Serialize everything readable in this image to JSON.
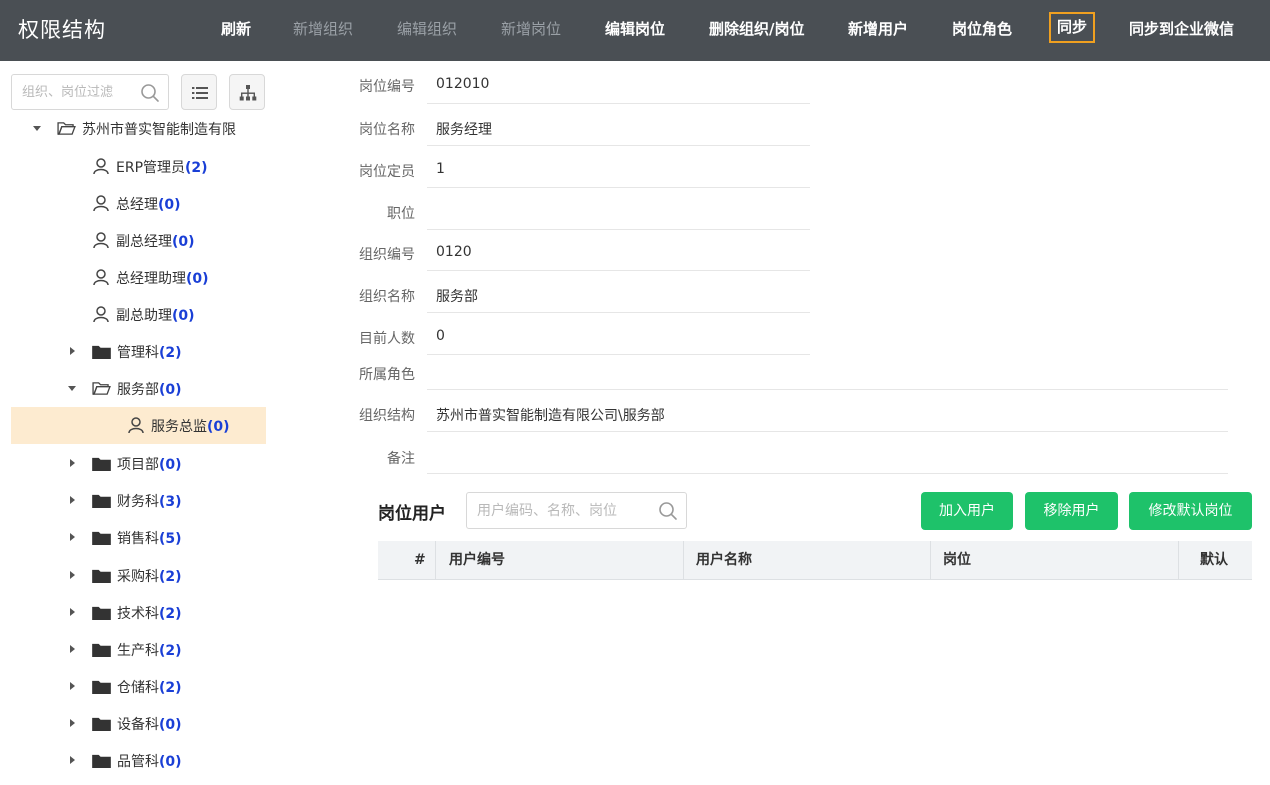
{
  "header": {
    "title": "权限结构",
    "toolbar": [
      {
        "label": "刷新",
        "enabled": true
      },
      {
        "label": "新增组织",
        "enabled": false
      },
      {
        "label": "编辑组织",
        "enabled": false
      },
      {
        "label": "新增岗位",
        "enabled": false
      },
      {
        "label": "编辑岗位",
        "enabled": true
      },
      {
        "label": "删除组织/岗位",
        "enabled": true
      },
      {
        "label": "新增用户",
        "enabled": true
      },
      {
        "label": "岗位角色",
        "enabled": true
      },
      {
        "label": "同步",
        "enabled": true,
        "highlighted": true
      },
      {
        "label": "同步到企业微信",
        "enabled": true
      }
    ]
  },
  "tree_search": {
    "placeholder": "组织、岗位过滤"
  },
  "tree": {
    "root": {
      "label": "苏州市普实智能制造有限",
      "icon": "folder-open-icon"
    },
    "nodes": [
      {
        "type": "post",
        "name": "ERP管理员",
        "count": "(2)"
      },
      {
        "type": "post",
        "name": "总经理",
        "count": "(0)"
      },
      {
        "type": "post",
        "name": "副总经理",
        "count": "(0)"
      },
      {
        "type": "post",
        "name": "总经理助理",
        "count": "(0)"
      },
      {
        "type": "post",
        "name": "副总助理",
        "count": "(0)"
      },
      {
        "type": "org",
        "name": "管理科",
        "count": "(2)",
        "expanded": false
      },
      {
        "type": "org",
        "name": "服务部",
        "count": "(0)",
        "expanded": true
      },
      {
        "type": "post",
        "name": "服务总监",
        "count": "(0)",
        "selected": true
      },
      {
        "type": "org",
        "name": "项目部",
        "count": "(0)",
        "expanded": false
      },
      {
        "type": "org",
        "name": "财务科",
        "count": "(3)",
        "expanded": false
      },
      {
        "type": "org",
        "name": "销售科",
        "count": "(5)",
        "expanded": false
      },
      {
        "type": "org",
        "name": "采购科",
        "count": "(2)",
        "expanded": false
      },
      {
        "type": "org",
        "name": "技术科",
        "count": "(2)",
        "expanded": false
      },
      {
        "type": "org",
        "name": "生产科",
        "count": "(2)",
        "expanded": false
      },
      {
        "type": "org",
        "name": "仓储科",
        "count": "(2)",
        "expanded": false
      },
      {
        "type": "org",
        "name": "设备科",
        "count": "(0)",
        "expanded": false
      },
      {
        "type": "org",
        "name": "品管科",
        "count": "(0)",
        "expanded": false
      }
    ]
  },
  "detail": {
    "fields": [
      {
        "label": "岗位编号",
        "value": "012010"
      },
      {
        "label": "岗位名称",
        "value": "服务经理"
      },
      {
        "label": "岗位定员",
        "value": "1"
      },
      {
        "label": "职位",
        "value": ""
      },
      {
        "label": "组织编号",
        "value": "0120"
      },
      {
        "label": "组织名称",
        "value": "服务部"
      },
      {
        "label": "目前人数",
        "value": "0"
      },
      {
        "label": "所属角色",
        "value": ""
      },
      {
        "label": "组织结构",
        "value": "苏州市普实智能制造有限公司\\服务部"
      },
      {
        "label": "备注",
        "value": ""
      }
    ]
  },
  "post_users": {
    "title": "岗位用户",
    "search_placeholder": "用户编码、名称、岗位",
    "buttons": {
      "add": "加入用户",
      "remove": "移除用户",
      "set_default": "修改默认岗位"
    },
    "columns": [
      "#",
      "用户编号",
      "用户名称",
      "岗位",
      "默认"
    ],
    "rows": []
  },
  "colors": {
    "topbar": "#4a4f54",
    "accent_green": "#1ec26a",
    "highlight_border": "#f0a020",
    "count_blue": "#1a3fd6",
    "selected_row": "#fdebd0"
  }
}
